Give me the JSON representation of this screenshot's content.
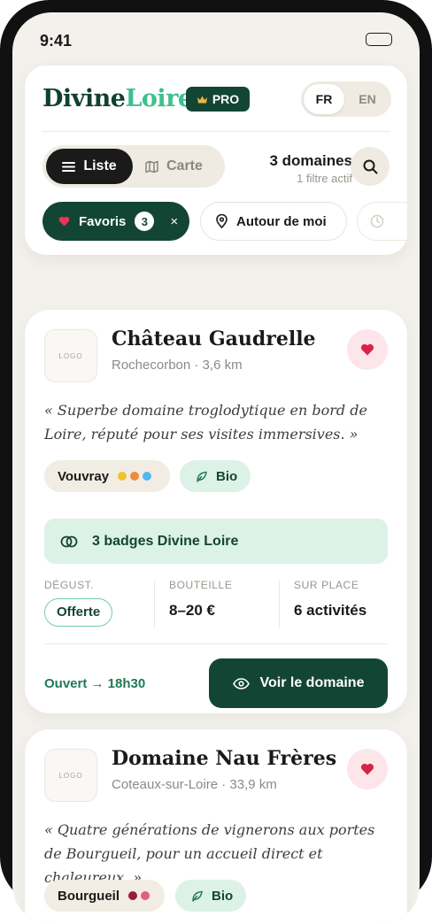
{
  "status_bar": {
    "time": "9:41"
  },
  "header": {
    "brand_part1": "Divine",
    "brand_part2": "Loire",
    "pro_label": "PRO",
    "languages": [
      "FR",
      "EN"
    ],
    "active_language": "FR"
  },
  "view_toggle": {
    "list_label": "Liste",
    "map_label": "Carte",
    "active": "Liste"
  },
  "results": {
    "title": "3 domaines",
    "subtitle": "1 filtre actif"
  },
  "filters": {
    "favorites_label": "Favoris",
    "favorites_count": "3",
    "remove_symbol": "×",
    "nearby_label": "Autour de moi"
  },
  "domains": [
    {
      "logo_placeholder": "LOGO",
      "name": "Château Gaudrelle",
      "location": "Rochecorbon · 3,6 km",
      "quote": "« Superbe domaine troglodytique en bord de Loire, réputé pour ses visites immersives. »",
      "appellation": "Vouvray",
      "appellation_dots": [
        "#f2c12e",
        "#ef8a3a",
        "#56b7ef"
      ],
      "bio_label": "Bio",
      "badges_label": "3 badges Divine Loire",
      "stats": {
        "tasting_label": "DÉGUST.",
        "tasting_value": "Offerte",
        "bottle_label": "BOUTEILLE",
        "bottle_value": "8–20 €",
        "onsite_label": "SUR PLACE",
        "onsite_value": "6 activités"
      },
      "open_status": "Ouvert → 18h30",
      "cta_label": "Voir le domaine"
    },
    {
      "logo_placeholder": "LOGO",
      "name": "Domaine Nau Frères",
      "location": "Coteaux-sur-Loire · 33,9 km",
      "quote": "« Quatre générations de vignerons aux portes de Bourgueil, pour un accueil direct et chaleureux. »",
      "appellation": "Bourgueil",
      "appellation_dots": [
        "#9b1b3a",
        "#e0607a"
      ],
      "bio_label": "Bio"
    }
  ],
  "colors": {
    "brand_dark": "#134535",
    "brand_mint": "#3fbf8f",
    "favorite_red": "#d8234a",
    "background": "#f3f1ec"
  }
}
